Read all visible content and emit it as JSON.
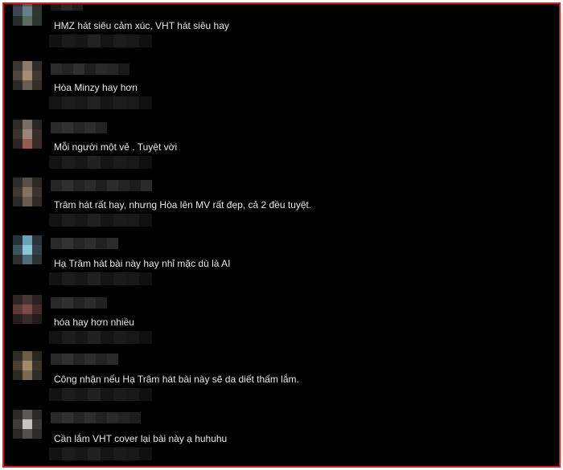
{
  "comments": [
    {
      "text": "HMZ hát siêu cảm xúc, VHT hát siêu hay"
    },
    {
      "text": "Hòa Minzy hay hơn"
    },
    {
      "text": "Mỗi người một vẻ . Tuyệt vời"
    },
    {
      "text": "Trâm hát rất hay, nhưng Hòa lên MV rất đẹp, cả 2 đều tuyệt."
    },
    {
      "text": "Hạ Trâm hát bài này hay nhỉ mặc dù là AI"
    },
    {
      "text": "hóa hay hơn nhiều"
    },
    {
      "text": "Công nhận nếu Hạ Trâm hát bài này sẽ da diết thấm lắm."
    },
    {
      "text": "Cần lắm VHT cover lại bài này ạ huhuhu"
    }
  ],
  "colors": {
    "frame_border": "#d81e1e",
    "background": "#000000",
    "comment_text": "#e9e9e9"
  }
}
